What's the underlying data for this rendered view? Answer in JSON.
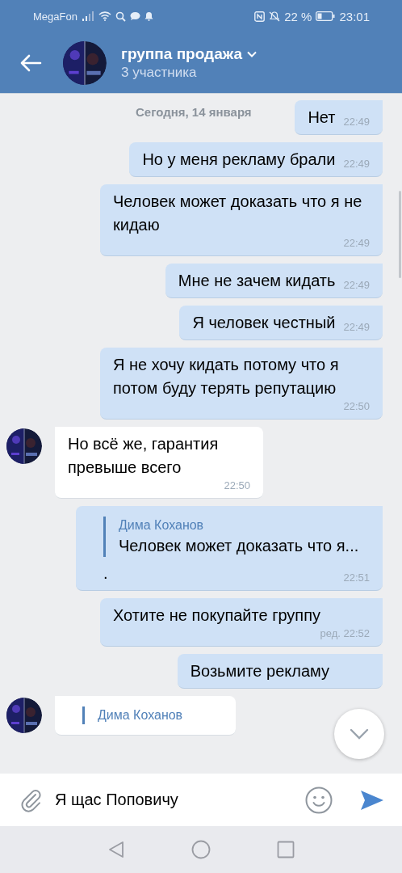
{
  "status_bar": {
    "carrier": "MegaFon",
    "battery_percent": "22 %",
    "time": "23:01"
  },
  "header": {
    "title": "группа продажа",
    "subtitle": "3 участника"
  },
  "date_divider": "Сегодня, 14 января",
  "messages": [
    {
      "kind": "out",
      "text": "Нет",
      "time": "22:49"
    },
    {
      "kind": "out",
      "text": "Но у меня рекламу брали",
      "time": "22:49"
    },
    {
      "kind": "out",
      "text": "Человек может доказать что я не кидаю",
      "time": "22:49"
    },
    {
      "kind": "out",
      "text": "Мне не зачем кидать",
      "time": "22:49"
    },
    {
      "kind": "out",
      "text": "Я человек честный",
      "time": "22:49"
    },
    {
      "kind": "out",
      "text": "Я не хочу кидать потому что я потом буду терять репутацию",
      "time": "22:50"
    },
    {
      "kind": "in",
      "text": "Но всё же, гарантия превыше всего",
      "time": "22:50"
    },
    {
      "kind": "out",
      "quote": {
        "author": "Дима Коханов",
        "text": "Человек может доказать что я..."
      },
      "text": ".",
      "time": "22:51"
    },
    {
      "kind": "out",
      "text": "Хотите не покупайте группу",
      "time": "ред. 22:52"
    },
    {
      "kind": "out",
      "text": "Возьмите рекламу"
    },
    {
      "kind": "in",
      "quote": {
        "author": "Дима Коханов"
      }
    }
  ],
  "composer": {
    "value": "Я щас Поповичу"
  }
}
